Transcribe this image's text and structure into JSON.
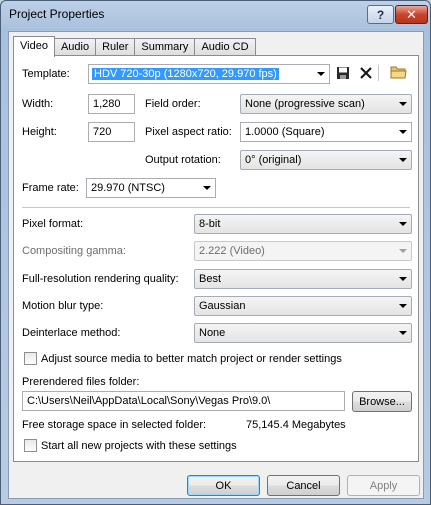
{
  "window": {
    "title": "Project Properties",
    "help_glyph": "?",
    "close_glyph": "✕"
  },
  "tabs": [
    {
      "label": "Video",
      "active": true
    },
    {
      "label": "Audio",
      "active": false
    },
    {
      "label": "Ruler",
      "active": false
    },
    {
      "label": "Summary",
      "active": false
    },
    {
      "label": "Audio CD",
      "active": false
    }
  ],
  "video": {
    "template_label": "Template:",
    "template_value": "HDV 720-30p (1280x720, 29.970 fps)",
    "width_label": "Width:",
    "width_value": "1,280",
    "height_label": "Height:",
    "height_value": "720",
    "field_order_label": "Field order:",
    "field_order_value": "None (progressive scan)",
    "pixel_aspect_label": "Pixel aspect ratio:",
    "pixel_aspect_value": "1.0000 (Square)",
    "output_rotation_label": "Output rotation:",
    "output_rotation_value": "0° (original)",
    "frame_rate_label": "Frame rate:",
    "frame_rate_value": "29.970 (NTSC)",
    "pixel_format_label": "Pixel format:",
    "pixel_format_value": "8-bit",
    "compositing_gamma_label": "Compositing gamma:",
    "compositing_gamma_value": "2.222 (Video)",
    "render_quality_label": "Full-resolution rendering quality:",
    "render_quality_value": "Best",
    "motion_blur_label": "Motion blur type:",
    "motion_blur_value": "Gaussian",
    "deinterlace_label": "Deinterlace method:",
    "deinterlace_value": "None",
    "adjust_source_label": "Adjust source media to better match project or render settings",
    "adjust_source_checked": false,
    "prerendered_label": "Prerendered files folder:",
    "prerendered_value": "C:\\Users\\Neil\\AppData\\Local\\Sony\\Vegas Pro\\9.0\\",
    "browse_label": "Browse...",
    "free_space_label": "Free storage space in selected folder:",
    "free_space_value": "75,145.4 Megabytes",
    "start_all_label": "Start all new projects with these settings",
    "start_all_checked": false
  },
  "buttons": {
    "ok": "OK",
    "cancel": "Cancel",
    "apply": "Apply"
  },
  "icons": {
    "save": "save-icon",
    "delete": "delete-icon",
    "folder": "folder-icon"
  },
  "colors": {
    "selection": "#3399ff",
    "close_button": "#c7452e"
  }
}
